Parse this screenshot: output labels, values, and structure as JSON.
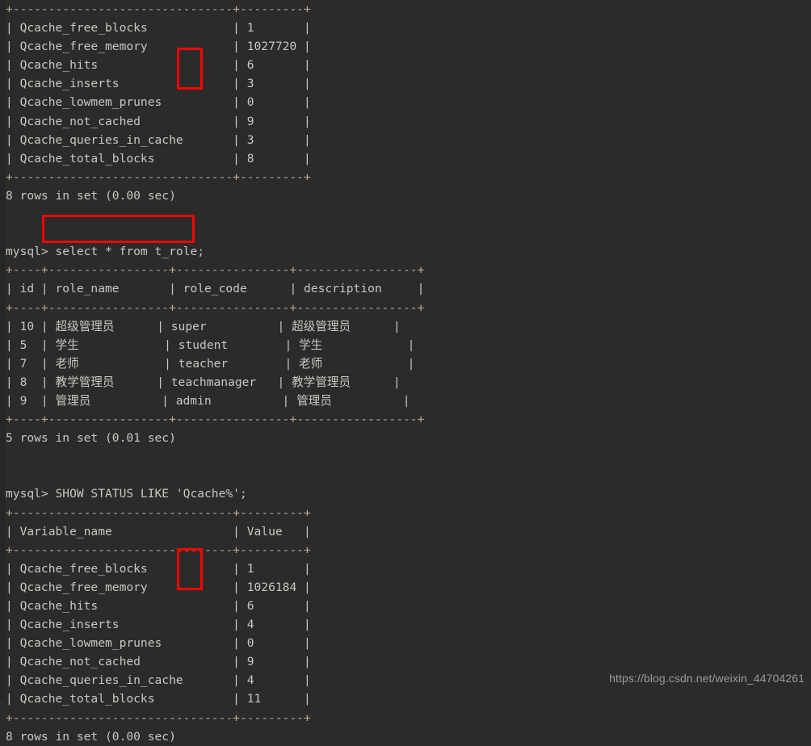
{
  "terminal": {
    "background_color": "#2b2b2b",
    "text_color": "#c8c5bd",
    "rule_color": "#b8a98f",
    "annotation_color": "#ff0000",
    "lines": [
      {
        "kind": "rule",
        "text": "+-------------------------------+---------+"
      },
      {
        "kind": "out",
        "text": "| Qcache_free_blocks            | 1       |"
      },
      {
        "kind": "out",
        "text": "| Qcache_free_memory            | 1027720 |"
      },
      {
        "kind": "out",
        "text": "| Qcache_hits                   | 6       |"
      },
      {
        "kind": "out",
        "text": "| Qcache_inserts                | 3       |"
      },
      {
        "kind": "out",
        "text": "| Qcache_lowmem_prunes          | 0       |"
      },
      {
        "kind": "out",
        "text": "| Qcache_not_cached             | 9       |"
      },
      {
        "kind": "out",
        "text": "| Qcache_queries_in_cache       | 3       |"
      },
      {
        "kind": "out",
        "text": "| Qcache_total_blocks           | 8       |"
      },
      {
        "kind": "rule",
        "text": "+-------------------------------+---------+"
      },
      {
        "kind": "out",
        "text": "8 rows in set (0.00 sec)"
      },
      {
        "kind": "blank",
        "text": " "
      },
      {
        "kind": "blank",
        "text": " "
      },
      {
        "kind": "prompt",
        "text": "mysql> select * from t_role;"
      },
      {
        "kind": "rule",
        "text": "+----+-----------------+----------------+-----------------+"
      },
      {
        "kind": "out",
        "text": "| id | role_name       | role_code      | description     |"
      },
      {
        "kind": "rule",
        "text": "+----+-----------------+----------------+-----------------+"
      },
      {
        "kind": "out",
        "text": "| 10 | 超级管理员      | super          | 超级管理员      |"
      },
      {
        "kind": "out",
        "text": "| 5  | 学生            | student        | 学生            |"
      },
      {
        "kind": "out",
        "text": "| 7  | 老师            | teacher        | 老师            |"
      },
      {
        "kind": "out",
        "text": "| 8  | 教学管理员      | teachmanager   | 教学管理员      |"
      },
      {
        "kind": "out",
        "text": "| 9  | 管理员          | admin          | 管理员          |"
      },
      {
        "kind": "rule",
        "text": "+----+-----------------+----------------+-----------------+"
      },
      {
        "kind": "out",
        "text": "5 rows in set (0.01 sec)"
      },
      {
        "kind": "blank",
        "text": " "
      },
      {
        "kind": "blank",
        "text": " "
      },
      {
        "kind": "prompt",
        "text": "mysql> SHOW STATUS LIKE 'Qcache%';"
      },
      {
        "kind": "rule",
        "text": "+-------------------------------+---------+"
      },
      {
        "kind": "out",
        "text": "| Variable_name                 | Value   |"
      },
      {
        "kind": "rule",
        "text": "+-------------------------------+---------+"
      },
      {
        "kind": "out",
        "text": "| Qcache_free_blocks            | 1       |"
      },
      {
        "kind": "out",
        "text": "| Qcache_free_memory            | 1026184 |"
      },
      {
        "kind": "out",
        "text": "| Qcache_hits                   | 6       |"
      },
      {
        "kind": "out",
        "text": "| Qcache_inserts                | 4       |"
      },
      {
        "kind": "out",
        "text": "| Qcache_lowmem_prunes          | 0       |"
      },
      {
        "kind": "out",
        "text": "| Qcache_not_cached             | 9       |"
      },
      {
        "kind": "out",
        "text": "| Qcache_queries_in_cache       | 4       |"
      },
      {
        "kind": "out",
        "text": "| Qcache_total_blocks           | 11      |"
      },
      {
        "kind": "rule",
        "text": "+-------------------------------+---------+"
      },
      {
        "kind": "out",
        "text": "8 rows in set (0.00 sec)"
      }
    ],
    "annotations": [
      {
        "name": "redbox-hits-inserts-1",
        "highlights": [
          "6",
          "3"
        ]
      },
      {
        "name": "redbox-query",
        "highlights": [
          "select * from t_role;"
        ]
      },
      {
        "name": "redbox-hits-inserts-2",
        "highlights": [
          "6",
          "4"
        ]
      }
    ]
  },
  "watermark": {
    "text": "https://blog.csdn.net/weixin_44704261"
  }
}
